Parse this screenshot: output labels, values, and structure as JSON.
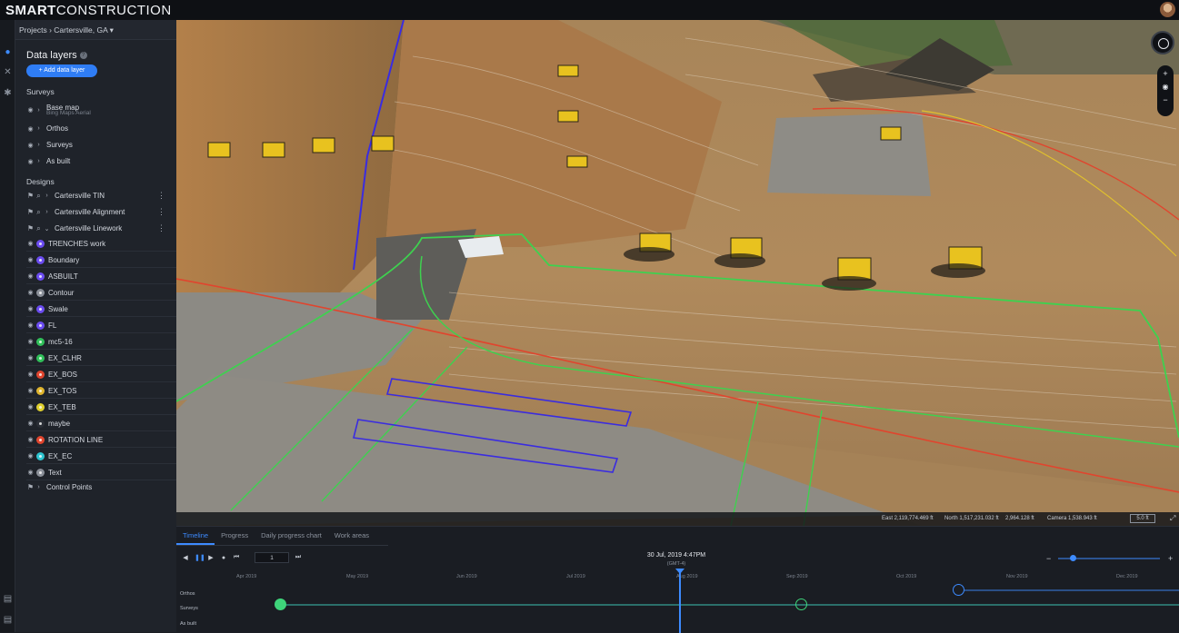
{
  "brand": {
    "bold": "SMART",
    "light": "CONSTRUCTION"
  },
  "breadcrumb": "Projects › Cartersville, GA ▾",
  "panel": {
    "title": "Data layers",
    "add_label": "+ Add data layer"
  },
  "sections": {
    "surveys": "Surveys",
    "designs": "Designs"
  },
  "surveys": [
    {
      "label": "Base map",
      "sub": "Bing Maps Aerial"
    },
    {
      "label": "Orthos"
    },
    {
      "label": "Surveys"
    },
    {
      "label": "As built"
    }
  ],
  "designs": [
    {
      "label": "Cartersville TIN"
    },
    {
      "label": "Cartersville Alignment"
    },
    {
      "label": "Cartersville Linework"
    }
  ],
  "layers": [
    {
      "label": "TRENCHES work",
      "color": "#6b4cf0"
    },
    {
      "label": "Boundary",
      "color": "#6b4cf0"
    },
    {
      "label": "ASBUILT",
      "color": "#6b4cf0"
    },
    {
      "label": "Contour",
      "color": "#8a8f98"
    },
    {
      "label": "Swale",
      "color": "#6b4cf0"
    },
    {
      "label": "FL",
      "color": "#6b4cf0"
    },
    {
      "label": "mc5-16",
      "color": "#31c05a"
    },
    {
      "label": "EX_CLHR",
      "color": "#31c05a"
    },
    {
      "label": "EX_BOS",
      "color": "#e0452e"
    },
    {
      "label": "EX_TOS",
      "color": "#e0b52e"
    },
    {
      "label": "EX_TEB",
      "color": "#e0d02e"
    },
    {
      "label": "maybe",
      "color": "#2a2e36"
    },
    {
      "label": "ROTATION LINE",
      "color": "#e0452e"
    },
    {
      "label": "EX_EC",
      "color": "#2ec4d0"
    },
    {
      "label": "Text",
      "color": "#8a8f98"
    }
  ],
  "control_points": "Control Points",
  "coords": {
    "east": "East 2,119,774.469 ft",
    "north": "North 1,517,231.032 ft",
    "elev": "2,964.128 ft",
    "camera": "Camera 1,538.943 ft",
    "scale": "5.0 ft"
  },
  "timeline": {
    "tabs": [
      "Timeline",
      "Progress",
      "Daily progress chart",
      "Work areas"
    ],
    "speed": "1",
    "datetime": "30 Jul, 2019 4:47PM",
    "timezone": "(GMT-4)",
    "months": [
      "Apr 2019",
      "May 2019",
      "Jun 2019",
      "Jul 2019",
      "Aug 2019",
      "Sep 2019",
      "Oct 2019",
      "Nov 2019",
      "Dec 2019"
    ],
    "tracks": [
      "Orthos",
      "Surveys",
      "As built"
    ],
    "zoom_level": 0.14
  },
  "icons": {
    "rail": [
      "layers-icon",
      "tools-icon",
      "settings-icon"
    ],
    "foot": [
      "document-icon",
      "report-icon"
    ]
  }
}
